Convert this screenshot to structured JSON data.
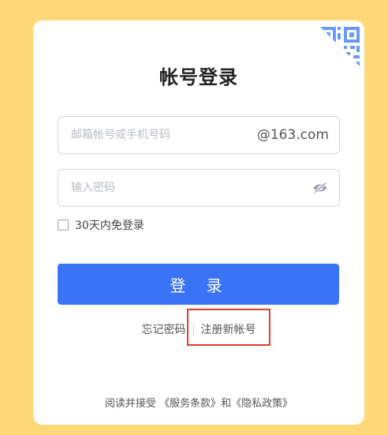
{
  "login": {
    "title": "帐号登录",
    "email_placeholder": "邮箱帐号或手机号码",
    "email_suffix": "@163.com",
    "password_placeholder": "输入密码",
    "remember_label": "30天内免登录",
    "login_button": "登 录",
    "forgot_password": "忘记密码",
    "register": "注册新帐号"
  },
  "agreement": {
    "prefix": "阅读并接受",
    "terms": "《服务条款》",
    "conj": "和",
    "privacy": "《隐私政策》"
  },
  "icons": {
    "qr": "qr-code-icon",
    "password_toggle": "eye-closed-icon"
  },
  "colors": {
    "background": "#FFD879",
    "primary": "#3A73F6",
    "qr_accent": "#6A9AF7",
    "highlight": "#E53935"
  }
}
